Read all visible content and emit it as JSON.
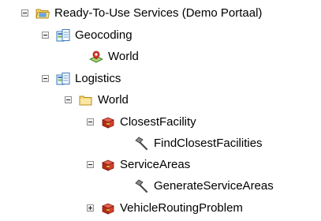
{
  "tree": {
    "root": {
      "label": "Ready-To-Use Services (Demo Portaal)",
      "toggle": "collapse",
      "icon": "server-folder-icon"
    },
    "items": [
      {
        "label": "Geocoding",
        "toggle": "collapse",
        "icon": "service-folder-icon"
      },
      {
        "label": "World",
        "icon": "geocode-service-icon"
      },
      {
        "label": "Logistics",
        "toggle": "collapse",
        "icon": "service-folder-icon"
      },
      {
        "label": "World",
        "toggle": "collapse",
        "icon": "folder-icon"
      },
      {
        "label": "ClosestFacility",
        "toggle": "collapse",
        "icon": "gp-toolbox-icon"
      },
      {
        "label": "FindClosestFacilities",
        "icon": "tool-hammer-icon"
      },
      {
        "label": "ServiceAreas",
        "toggle": "collapse",
        "icon": "gp-toolbox-icon"
      },
      {
        "label": "GenerateServiceAreas",
        "icon": "tool-hammer-icon"
      },
      {
        "label": "VehicleRoutingProblem",
        "toggle": "expand",
        "icon": "gp-toolbox-icon"
      }
    ]
  }
}
